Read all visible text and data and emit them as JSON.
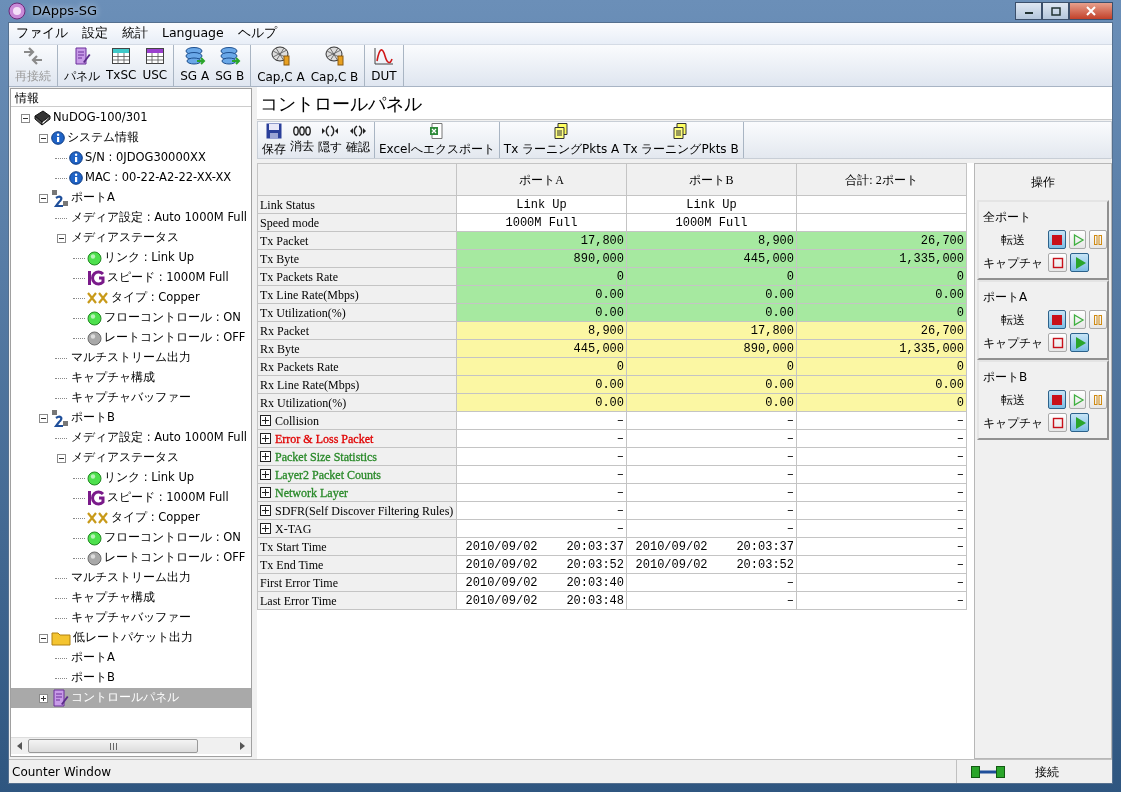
{
  "window": {
    "title": "DApps-SG"
  },
  "menu": [
    {
      "label": "ファイル"
    },
    {
      "label": "設定"
    },
    {
      "label": "統計"
    },
    {
      "label": "Language"
    },
    {
      "label": "ヘルプ"
    }
  ],
  "toolbar": [
    {
      "items": [
        {
          "label": "再接続",
          "disabled": true
        }
      ]
    },
    {
      "items": [
        {
          "label": "パネル",
          "disabled": false
        },
        {
          "label": "TxSC",
          "disabled": false
        },
        {
          "label": "USC",
          "disabled": false
        }
      ]
    },
    {
      "items": [
        {
          "label": "SG A",
          "disabled": false
        },
        {
          "label": "SG B",
          "disabled": false
        }
      ]
    },
    {
      "items": [
        {
          "label": "Cap,C A",
          "disabled": false
        },
        {
          "label": "Cap,C B",
          "disabled": false
        }
      ]
    },
    {
      "items": [
        {
          "label": "DUT",
          "disabled": false
        }
      ]
    }
  ],
  "sidebar": {
    "header": "情報",
    "tree": [
      {
        "label": "NuDOG-100/301",
        "kind": "device",
        "expanded": true,
        "selected": false,
        "children": [
          {
            "label": "システム情報",
            "kind": "info",
            "expanded": true,
            "selected": false,
            "children": [
              {
                "label": "S/N : 0JDOG30000XX",
                "kind": "info",
                "selected": false
              },
              {
                "label": "MAC : 00-22-A2-22-XX-XX",
                "kind": "info",
                "selected": false
              }
            ]
          },
          {
            "label": "ポートA",
            "kind": "port",
            "expanded": true,
            "selected": false,
            "children": [
              {
                "label": "メディア設定 : Auto 1000M Full",
                "kind": "text",
                "selected": false
              },
              {
                "label": "メディアステータス",
                "kind": "text",
                "expanded": true,
                "selected": false,
                "children": [
                  {
                    "label": "リンク : Link Up",
                    "kind": "led",
                    "on": true,
                    "selected": false
                  },
                  {
                    "label": "スピード : 1000M Full",
                    "kind": "speed",
                    "selected": false
                  },
                  {
                    "label": "タイプ : Copper",
                    "kind": "cable",
                    "selected": false
                  },
                  {
                    "label": "フローコントロール : ON",
                    "kind": "led",
                    "on": true,
                    "selected": false
                  },
                  {
                    "label": "レートコントロール : OFF",
                    "kind": "led",
                    "on": false,
                    "selected": false
                  }
                ]
              },
              {
                "label": "マルチストリーム出力",
                "kind": "text",
                "selected": false
              },
              {
                "label": "キャプチャ構成",
                "kind": "text",
                "selected": false
              },
              {
                "label": "キャプチャバッファー",
                "kind": "text",
                "selected": false
              }
            ]
          },
          {
            "label": "ポートB",
            "kind": "port",
            "expanded": true,
            "selected": false,
            "children": [
              {
                "label": "メディア設定 : Auto 1000M Full",
                "kind": "text",
                "selected": false
              },
              {
                "label": "メディアステータス",
                "kind": "text",
                "expanded": true,
                "selected": false,
                "children": [
                  {
                    "label": "リンク : Link Up",
                    "kind": "led",
                    "on": true,
                    "selected": false
                  },
                  {
                    "label": "スピード : 1000M Full",
                    "kind": "speed",
                    "selected": false
                  },
                  {
                    "label": "タイプ : Copper",
                    "kind": "cable",
                    "selected": false
                  },
                  {
                    "label": "フローコントロール : ON",
                    "kind": "led",
                    "on": true,
                    "selected": false
                  },
                  {
                    "label": "レートコントロール : OFF",
                    "kind": "led",
                    "on": false,
                    "selected": false
                  }
                ]
              },
              {
                "label": "マルチストリーム出力",
                "kind": "text",
                "selected": false
              },
              {
                "label": "キャプチャ構成",
                "kind": "text",
                "selected": false
              },
              {
                "label": "キャプチャバッファー",
                "kind": "text",
                "selected": false
              }
            ]
          },
          {
            "label": "低レートパケット出力",
            "kind": "folder",
            "expanded": true,
            "selected": false,
            "children": [
              {
                "label": "ポートA",
                "kind": "text",
                "selected": false
              },
              {
                "label": "ポートB",
                "kind": "text",
                "selected": false
              }
            ]
          },
          {
            "label": "コントロールパネル",
            "kind": "panel",
            "expanded": false,
            "selected": true
          }
        ]
      }
    ]
  },
  "panel": {
    "title": "コントロールパネル",
    "toolbar": [
      {
        "items": [
          {
            "label": "保存"
          },
          {
            "label": "消去"
          },
          {
            "label": "隠す"
          },
          {
            "label": "確認"
          }
        ]
      },
      {
        "items": [
          {
            "label": "Excelへエクスポート"
          }
        ]
      },
      {
        "items": [
          {
            "label": "Tx ラーニングPkts A"
          },
          {
            "label": "Tx ラーニングPkts B"
          }
        ]
      }
    ],
    "table": {
      "columns": [
        "ポートA",
        "ポートB",
        "合計: 2ポート"
      ],
      "rows": [
        {
          "label": "Link Status",
          "kind": "status",
          "values": [
            "Link Up",
            "Link Up"
          ]
        },
        {
          "label": "Speed mode",
          "kind": "status",
          "values": [
            "1000M Full",
            "1000M Full"
          ]
        },
        {
          "label": "Tx Packet",
          "kind": "tx",
          "values": [
            "17,800",
            "8,900",
            "26,700"
          ]
        },
        {
          "label": "Tx Byte",
          "kind": "tx",
          "values": [
            "890,000",
            "445,000",
            "1,335,000"
          ]
        },
        {
          "label": "Tx Packets Rate",
          "kind": "tx",
          "values": [
            "0",
            "0",
            "0"
          ]
        },
        {
          "label": "Tx Line Rate(Mbps)",
          "kind": "tx",
          "values": [
            "0.00",
            "0.00",
            "0.00"
          ]
        },
        {
          "label": "Tx Utilization(%)",
          "kind": "tx",
          "values": [
            "0.00",
            "0.00",
            "0"
          ]
        },
        {
          "label": "Rx Packet",
          "kind": "rx",
          "values": [
            "8,900",
            "17,800",
            "26,700"
          ]
        },
        {
          "label": "Rx Byte",
          "kind": "rx",
          "values": [
            "445,000",
            "890,000",
            "1,335,000"
          ]
        },
        {
          "label": "Rx Packets Rate",
          "kind": "rx",
          "values": [
            "0",
            "0",
            "0"
          ]
        },
        {
          "label": "Rx Line Rate(Mbps)",
          "kind": "rx",
          "values": [
            "0.00",
            "0.00",
            "0.00"
          ]
        },
        {
          "label": "Rx Utilization(%)",
          "kind": "rx",
          "values": [
            "0.00",
            "0.00",
            "0"
          ]
        },
        {
          "label": "Collision",
          "kind": "group",
          "values": [
            "–",
            "–",
            "–"
          ]
        },
        {
          "label": "Error & Loss Packet",
          "kind": "group",
          "color": "#e00000",
          "values": [
            "–",
            "–",
            "–"
          ]
        },
        {
          "label": "Packet Size Statistics",
          "kind": "group",
          "color": "#2a8a2a",
          "values": [
            "–",
            "–",
            "–"
          ]
        },
        {
          "label": "Layer2 Packet Counts",
          "kind": "group",
          "color": "#2a8a2a",
          "values": [
            "–",
            "–",
            "–"
          ]
        },
        {
          "label": "Network Layer",
          "kind": "group",
          "color": "#2a8a2a",
          "values": [
            "–",
            "–",
            "–"
          ]
        },
        {
          "label": "SDFR(Self Discover Filtering Rules)",
          "kind": "group",
          "values": [
            "–",
            "–",
            "–"
          ]
        },
        {
          "label": "X-TAG",
          "kind": "group",
          "values": [
            "–",
            "–",
            "–"
          ]
        },
        {
          "label": "Tx Start Time",
          "kind": "time",
          "values": [
            "2010/09/02    20:03:37",
            "2010/09/02    20:03:37",
            "–"
          ]
        },
        {
          "label": "Tx End Time",
          "kind": "time",
          "values": [
            "2010/09/02    20:03:52",
            "2010/09/02    20:03:52",
            "–"
          ]
        },
        {
          "label": "First Error Time",
          "kind": "time",
          "values": [
            "2010/09/02    20:03:40",
            "–",
            "–"
          ]
        },
        {
          "label": "Last Error Time",
          "kind": "time",
          "values": [
            "2010/09/02    20:03:48",
            "–",
            "–"
          ]
        }
      ]
    }
  },
  "operations": {
    "title": "操作",
    "sections": [
      {
        "title": "全ポート",
        "controls": [
          {
            "label": "転送",
            "buttons": [
              {
                "kind": "stop",
                "pressed": true
              },
              {
                "kind": "play",
                "pressed": false
              },
              {
                "kind": "pause",
                "pressed": false
              }
            ]
          },
          {
            "label": "キャプチャ",
            "buttons": [
              {
                "kind": "stop",
                "pressed": false
              },
              {
                "kind": "play",
                "pressed": true
              }
            ]
          }
        ]
      },
      {
        "title": "ポートA",
        "controls": [
          {
            "label": "転送",
            "buttons": [
              {
                "kind": "stop",
                "pressed": true
              },
              {
                "kind": "play",
                "pressed": false
              },
              {
                "kind": "pause",
                "pressed": false
              }
            ]
          },
          {
            "label": "キャプチャ",
            "buttons": [
              {
                "kind": "stop",
                "pressed": false
              },
              {
                "kind": "play",
                "pressed": true
              }
            ]
          }
        ]
      },
      {
        "title": "ポートB",
        "controls": [
          {
            "label": "転送",
            "buttons": [
              {
                "kind": "stop",
                "pressed": true
              },
              {
                "kind": "play",
                "pressed": false
              },
              {
                "kind": "pause",
                "pressed": false
              }
            ]
          },
          {
            "label": "キャプチャ",
            "buttons": [
              {
                "kind": "stop",
                "pressed": false
              },
              {
                "kind": "play",
                "pressed": true
              }
            ]
          }
        ]
      }
    ]
  },
  "status_bar": {
    "text": "Counter Window",
    "connection": "接続"
  }
}
